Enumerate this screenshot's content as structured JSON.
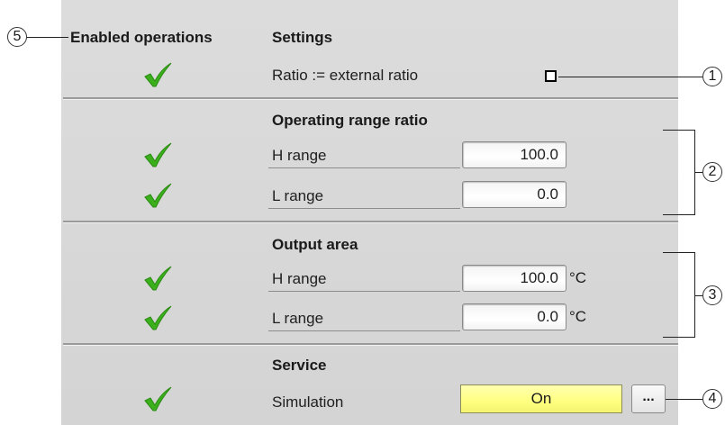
{
  "headers": {
    "enabled_operations": "Enabled operations",
    "settings": "Settings"
  },
  "settings": {
    "ratio_label": "Ratio := external ratio",
    "ratio_checked": false
  },
  "operating_range": {
    "title": "Operating range ratio",
    "h_label": "H range",
    "h_value": "100.0",
    "l_label": "L range",
    "l_value": "0.0"
  },
  "output_area": {
    "title": "Output area",
    "h_label": "H range",
    "h_value": "100.0",
    "h_unit": "°C",
    "l_label": "L range",
    "l_value": "0.0",
    "l_unit": "°C"
  },
  "service": {
    "title": "Service",
    "simulation_label": "Simulation",
    "simulation_value": "On",
    "more_button": "..."
  },
  "callouts": {
    "c1": "1",
    "c2": "2",
    "c3": "3",
    "c4": "4",
    "c5": "5"
  },
  "colors": {
    "panel_bg": "#d9d9d9",
    "check_green": "#3cb01c",
    "on_button": "#ffff80"
  },
  "icons": {
    "enabled": "checkmark-icon"
  }
}
